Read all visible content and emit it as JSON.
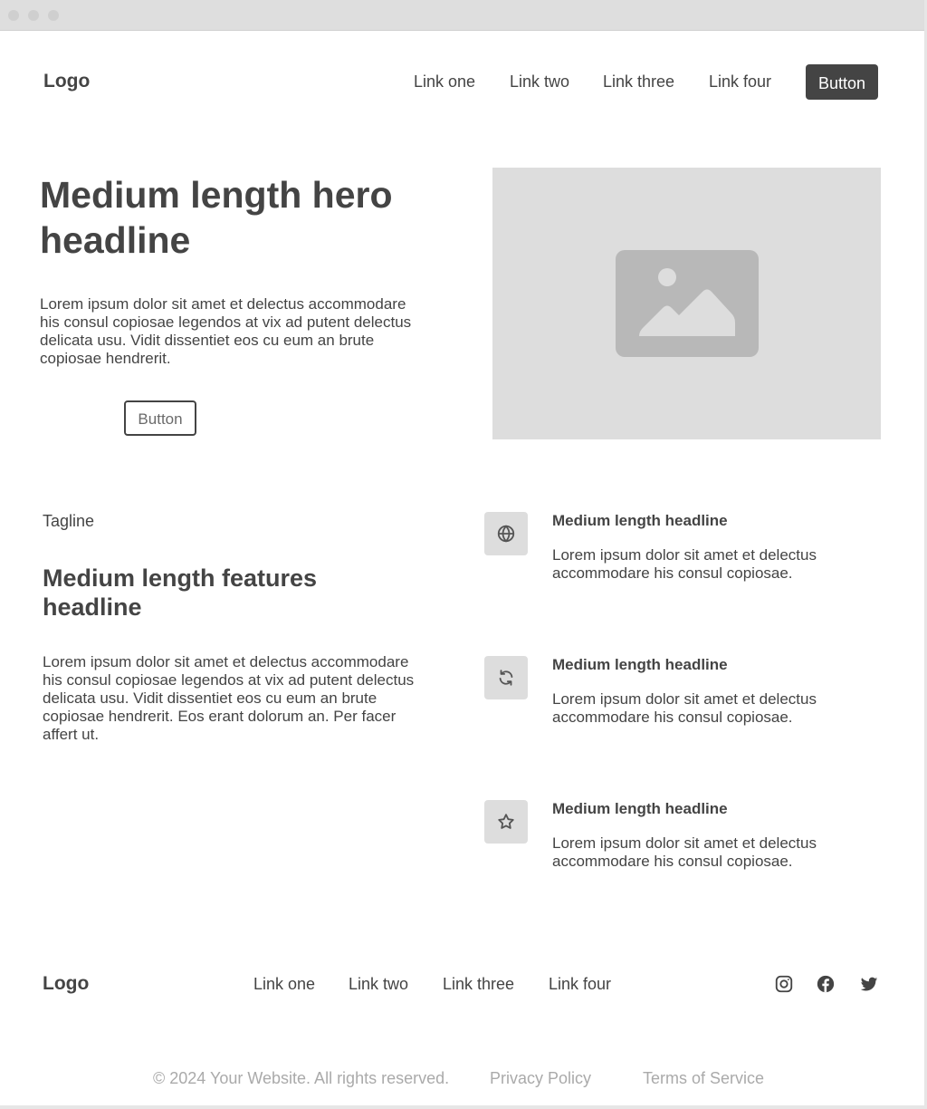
{
  "header": {
    "logo": "Logo",
    "nav": [
      "Link one",
      "Link two",
      "Link three",
      "Link four"
    ],
    "button": "Button"
  },
  "hero": {
    "headline": "Medium length hero headline",
    "body": "Lorem ipsum dolor sit amet et delectus accommodare his consul copiosae legendos at vix ad putent delectus delicata usu. Vidit dissentiet eos cu eum an brute copiosae hendrerit.",
    "button": "Button",
    "image_icon": "image-placeholder-icon"
  },
  "features": {
    "tagline": "Tagline",
    "headline": "Medium length features headline",
    "body": "Lorem ipsum dolor sit amet et delectus accommodare his consul copiosae legendos at vix ad putent delectus delicata usu. Vidit dissentiet eos cu eum an brute copiosae hendrerit. Eos erant dolorum an. Per facer affert ut.",
    "items": [
      {
        "icon": "globe-icon",
        "title": "Medium length headline",
        "text": "Lorem ipsum dolor sit amet et delectus accommodare his consul copiosae."
      },
      {
        "icon": "refresh-icon",
        "title": "Medium length headline",
        "text": "Lorem ipsum dolor sit amet et delectus accommodare his consul copiosae."
      },
      {
        "icon": "star-icon",
        "title": "Medium length headline",
        "text": "Lorem ipsum dolor sit amet et delectus accommodare his consul copiosae."
      }
    ]
  },
  "footer": {
    "logo": "Logo",
    "links": [
      "Link one",
      "Link two",
      "Link three",
      "Link four"
    ],
    "social": [
      "instagram-icon",
      "facebook-icon",
      "twitter-icon"
    ],
    "copyright": "© 2024 Your Website. All rights reserved.",
    "privacy": "Privacy Policy",
    "terms": "Terms of Service"
  },
  "colors": {
    "text": "#444444",
    "button_bg": "#444444",
    "placeholder_bg": "#dddddd",
    "muted_text": "#aaaaaa"
  }
}
